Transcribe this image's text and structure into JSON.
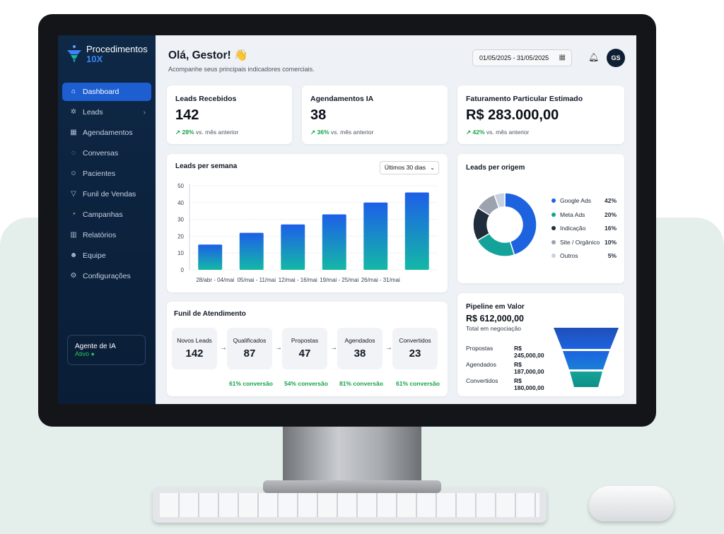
{
  "brand": {
    "name": "Procedimentos",
    "sub": "10X"
  },
  "sidebar": {
    "items": [
      {
        "label": "Dashboard",
        "icon": "home-icon"
      },
      {
        "label": "Leads",
        "icon": "gear-icon"
      },
      {
        "label": "Agendamentos",
        "icon": "calendar-icon"
      },
      {
        "label": "Conversas",
        "icon": "chat-icon"
      },
      {
        "label": "Pacientes",
        "icon": "user-icon"
      },
      {
        "label": "Funil de Vendas",
        "icon": "filter-icon"
      },
      {
        "label": "Campanhas",
        "icon": "megaphone-icon"
      },
      {
        "label": "Relatórios",
        "icon": "bar-chart-icon"
      },
      {
        "label": "Equipe",
        "icon": "users-icon"
      },
      {
        "label": "Configurações",
        "icon": "settings-icon"
      }
    ],
    "agent": {
      "title": "Agente de IA",
      "status": "Ativo"
    }
  },
  "header": {
    "greeting": "Olá, Gestor! 👋",
    "subtitle": "Acompanhe seus principais indicadores comerciais.",
    "date_range": "01/05/2025 - 31/05/2025",
    "avatar": "GS"
  },
  "kpis": [
    {
      "title": "Leads Recebidos",
      "value": "142",
      "pct": "28%",
      "suffix": "vs. mês anterior"
    },
    {
      "title": "Agendamentos IA",
      "value": "38",
      "pct": "36%",
      "suffix": "vs. mês anterior"
    },
    {
      "title": "Faturamento Particular Estimado",
      "value": "R$ 283.000,00",
      "pct": "42%",
      "suffix": "vs. mês anterior"
    }
  ],
  "weekly": {
    "title": "Leads per semana",
    "filter": "Últimos 30 dias"
  },
  "origin": {
    "title": "Leads per origem"
  },
  "funnel": {
    "title": "Funil de Atendimento",
    "stages": [
      {
        "label": "Novos Leads",
        "value": "142"
      },
      {
        "label": "Qualificados",
        "value": "87"
      },
      {
        "label": "Propostas",
        "value": "47"
      },
      {
        "label": "Agendados",
        "value": "38"
      },
      {
        "label": "Convertidos",
        "value": "23"
      }
    ],
    "conversions": [
      "61% conversão",
      "54% conversão",
      "81% conversão",
      "61% conversão"
    ]
  },
  "pipeline": {
    "title": "Pipeline em Valor",
    "total": "R$ 612,000,00",
    "total_label": "Total em negociação",
    "rows": [
      {
        "label": "Propostas",
        "value": "R$ 245,000,00"
      },
      {
        "label": "Agendados",
        "value": "R$ 187,000,00"
      },
      {
        "label": "Convertidos",
        "value": "R$ 180,000,00"
      }
    ]
  },
  "chart_data": [
    {
      "type": "bar",
      "title": "Leads per semana",
      "categories": [
        "28/abr - 04/mai",
        "05/mai - 11/mai",
        "12/mai - 16/mai",
        "19/mai - 25/mai",
        "26/mai - 31/mai"
      ],
      "values": [
        15,
        22,
        27,
        33,
        40,
        46
      ],
      "ylim": [
        0,
        50
      ],
      "yticks": [
        "50",
        "40",
        "30",
        "20",
        "10",
        "0"
      ],
      "colors": {
        "top": "#1d5fe8",
        "bottom": "#14b8a6"
      }
    },
    {
      "type": "pie",
      "title": "Leads per origem",
      "labels": [
        "Google Ads",
        "Meta Ads",
        "Indicação",
        "Site / Orgânico",
        "Outros"
      ],
      "values": [
        42,
        20,
        16,
        10,
        5
      ],
      "display": [
        "42%",
        "20%",
        "16%",
        "10%",
        "5%"
      ],
      "colors": [
        "#1d63e0",
        "#14a39a",
        "#1f2d3d",
        "#9ca3af",
        "#c7d2e0"
      ]
    }
  ]
}
